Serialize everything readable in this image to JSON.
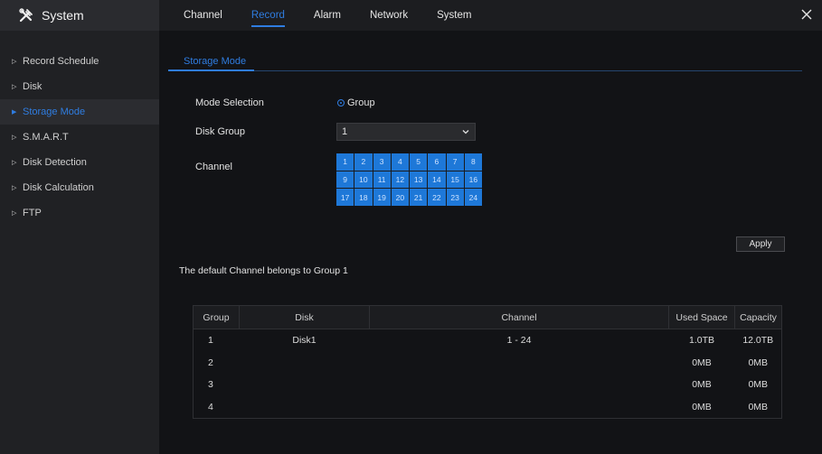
{
  "app": {
    "title": "System",
    "logo_icon": "tools-icon"
  },
  "tabs": [
    {
      "label": "Channel",
      "active": false
    },
    {
      "label": "Record",
      "active": true
    },
    {
      "label": "Alarm",
      "active": false
    },
    {
      "label": "Network",
      "active": false
    },
    {
      "label": "System",
      "active": false
    }
  ],
  "sidebar": {
    "items": [
      {
        "label": "Record Schedule",
        "active": false
      },
      {
        "label": "Disk",
        "active": false
      },
      {
        "label": "Storage Mode",
        "active": true
      },
      {
        "label": "S.M.A.R.T",
        "active": false
      },
      {
        "label": "Disk Detection",
        "active": false
      },
      {
        "label": "Disk Calculation",
        "active": false
      },
      {
        "label": "FTP",
        "active": false
      }
    ]
  },
  "main": {
    "subtab": "Storage Mode",
    "mode_selection_label": "Mode Selection",
    "mode_option": "Group",
    "disk_group_label": "Disk Group",
    "disk_group_value": "1",
    "channel_label": "Channel",
    "channels": [
      "1",
      "2",
      "3",
      "4",
      "5",
      "6",
      "7",
      "8",
      "9",
      "10",
      "11",
      "12",
      "13",
      "14",
      "15",
      "16",
      "17",
      "18",
      "19",
      "20",
      "21",
      "22",
      "23",
      "24"
    ],
    "apply_label": "Apply",
    "note": "The default Channel belongs to Group 1"
  },
  "table": {
    "headers": [
      "Group",
      "Disk",
      "Channel",
      "Used Space",
      "Capacity"
    ],
    "rows": [
      [
        "1",
        "Disk1",
        "1 - 24",
        "1.0TB",
        "12.0TB"
      ],
      [
        "2",
        "",
        "",
        "0MB",
        "0MB"
      ],
      [
        "3",
        "",
        "",
        "0MB",
        "0MB"
      ],
      [
        "4",
        "",
        "",
        "0MB",
        "0MB"
      ]
    ]
  },
  "colors": {
    "accent": "#2f7de1",
    "channel_cell": "#1e78d8",
    "background": "#121316"
  }
}
